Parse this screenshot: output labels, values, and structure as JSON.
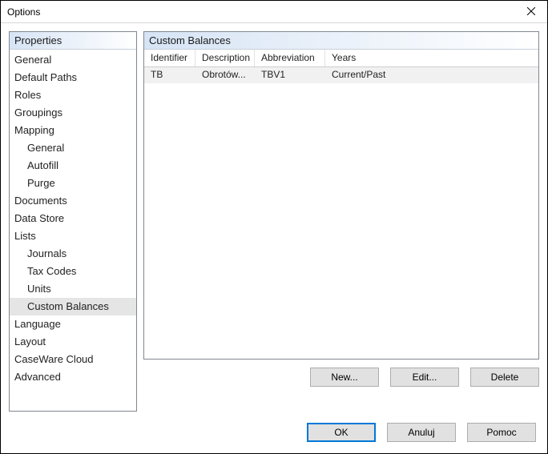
{
  "window": {
    "title": "Options"
  },
  "sidebar": {
    "header": "Properties",
    "items": [
      {
        "label": "General",
        "indent": 0
      },
      {
        "label": "Default Paths",
        "indent": 0
      },
      {
        "label": "Roles",
        "indent": 0
      },
      {
        "label": "Groupings",
        "indent": 0
      },
      {
        "label": "Mapping",
        "indent": 0
      },
      {
        "label": "General",
        "indent": 1
      },
      {
        "label": "Autofill",
        "indent": 1
      },
      {
        "label": "Purge",
        "indent": 1
      },
      {
        "label": "Documents",
        "indent": 0
      },
      {
        "label": "Data Store",
        "indent": 0
      },
      {
        "label": "Lists",
        "indent": 0
      },
      {
        "label": "Journals",
        "indent": 1
      },
      {
        "label": "Tax Codes",
        "indent": 1
      },
      {
        "label": "Units",
        "indent": 1
      },
      {
        "label": "Custom Balances",
        "indent": 1,
        "selected": true
      },
      {
        "label": "Language",
        "indent": 0
      },
      {
        "label": "Layout",
        "indent": 0
      },
      {
        "label": "CaseWare Cloud",
        "indent": 0
      },
      {
        "label": "Advanced",
        "indent": 0
      }
    ]
  },
  "main": {
    "header": "Custom Balances",
    "columns": {
      "identifier": "Identifier",
      "description": "Description",
      "abbreviation": "Abbreviation",
      "years": "Years"
    },
    "row": {
      "identifier": "TB",
      "description": "Obrotów...",
      "abbreviation": "TBV1",
      "years": "Current/Past"
    },
    "buttons": {
      "new": "New...",
      "edit": "Edit...",
      "delete": "Delete"
    }
  },
  "footer": {
    "ok": "OK",
    "cancel": "Anuluj",
    "help": "Pomoc"
  }
}
